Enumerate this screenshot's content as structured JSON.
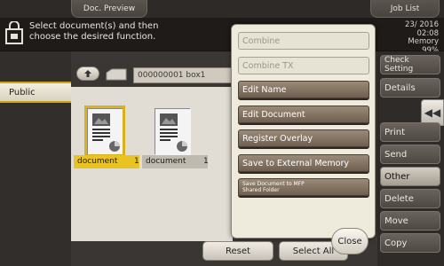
{
  "tabs": {
    "doc_preview": "Doc. Preview",
    "job_list": "Job List"
  },
  "message": {
    "line1": "Select document(s) and then",
    "line2": "choose the desired function."
  },
  "status": {
    "date": "23/ 2016",
    "time": "02:08",
    "memory_label": "Memory",
    "memory_value": "99%"
  },
  "left_nav": {
    "public": "Public"
  },
  "path": {
    "box_name": "000000001  box1"
  },
  "documents": [
    {
      "name": "document",
      "count": "1"
    },
    {
      "name": "document",
      "count": "1"
    }
  ],
  "bottom": {
    "reset": "Reset",
    "select_all": "Select All"
  },
  "right_menu": {
    "check_setting": "Check Setting",
    "details": "Details",
    "print": "Print",
    "send": "Send",
    "other": "Other",
    "delete": "Delete",
    "move": "Move",
    "copy": "Copy"
  },
  "popup": {
    "combine": "Combine",
    "combine_tx": "Combine TX",
    "edit_name": "Edit Name",
    "edit_document": "Edit Document",
    "register_overlay": "Register Overlay",
    "save_external": "Save to External Memory",
    "save_mfp_line1": "Save Document to MFP",
    "save_mfp_line2": "Shared Folder",
    "close": "Close"
  },
  "colors": {
    "accent_yellow": "#e8c321",
    "popup_bg": "#efebdc",
    "enabled_button": "#8a7a68"
  }
}
